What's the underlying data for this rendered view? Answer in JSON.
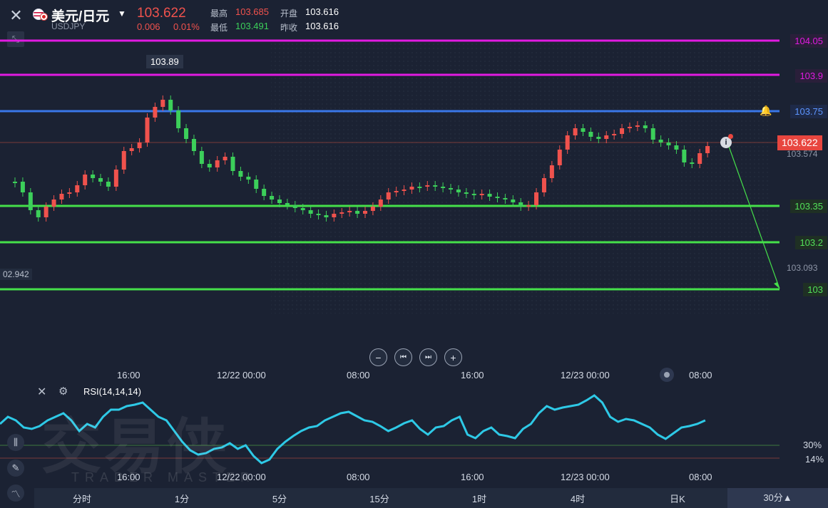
{
  "header": {
    "pair": "美元/日元",
    "symbol": "USDJPY",
    "price": "103.622",
    "change": "0.006",
    "change_pct": "0.01%",
    "high_label": "最高",
    "high": "103.685",
    "low_label": "最低",
    "low": "103.491",
    "open_label": "开盘",
    "open": "103.616",
    "prev_label": "昨收",
    "prev": "103.616"
  },
  "price_lines": [
    {
      "value": "104.05",
      "color": "#e11ae1"
    },
    {
      "value": "103.9",
      "color": "#e11ae1"
    },
    {
      "value": "103.75",
      "color": "#3a77e8"
    },
    {
      "value": "103.35",
      "color": "#45e04a"
    },
    {
      "value": "103.2",
      "color": "#45e04a"
    },
    {
      "value": "103",
      "color": "#45e04a"
    }
  ],
  "current_price_tag": "103.622",
  "right_labels": {
    "upper": "103.574",
    "lower": "103.093"
  },
  "left_label": "02.942",
  "peak_label": "103.89",
  "time_axis": [
    "16:00",
    "12/22 00:00",
    "08:00",
    "16:00",
    "12/23 00:00",
    "08:00"
  ],
  "rsi": {
    "label": "RSI(14,14,14)",
    "level_high": "30%",
    "level_low": "14%"
  },
  "watermark": {
    "cn": "交易侠",
    "en": "TRADER MASTER"
  },
  "tabs": [
    "分时",
    "1分",
    "5分",
    "15分",
    "1时",
    "4时",
    "日K",
    "30分▲"
  ],
  "icons": {
    "close": "close-icon",
    "shrink": "shrink-icon",
    "bell": "bell-icon",
    "info": "info-icon",
    "record": "record-icon",
    "settings": "gear-icon"
  }
}
